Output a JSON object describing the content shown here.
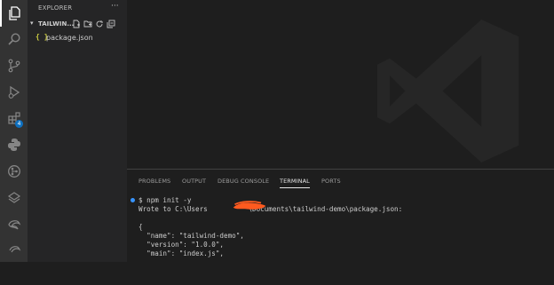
{
  "activity_bar": {
    "items": [
      "explorer-icon",
      "search-icon",
      "source-control-icon",
      "run-debug-icon",
      "extensions-icon",
      "python-icon",
      "gitlens-icon",
      "docker-icon",
      "remote-icon"
    ],
    "extensions_badge": "4"
  },
  "sidebar": {
    "title": "EXPLORER",
    "more": "···",
    "folder": {
      "name": "TAILWIN..."
    },
    "files": [
      {
        "icon": "{ }",
        "name": "package.json"
      }
    ]
  },
  "panel": {
    "tabs": [
      "PROBLEMS",
      "OUTPUT",
      "DEBUG CONSOLE",
      "TERMINAL",
      "PORTS"
    ],
    "active_tab": "TERMINAL",
    "terminal_lines": [
      "$ npm init -y",
      "Wrote to C:\\Users          \\Documents\\tailwind-demo\\package.json:",
      "",
      "{",
      "  \"name\": \"tailwind-demo\",",
      "  \"version\": \"1.0.0\",",
      "  \"main\": \"index.js\","
    ]
  },
  "colors": {
    "accent": "#0e70c0",
    "redaction": "#ff5a1f"
  }
}
